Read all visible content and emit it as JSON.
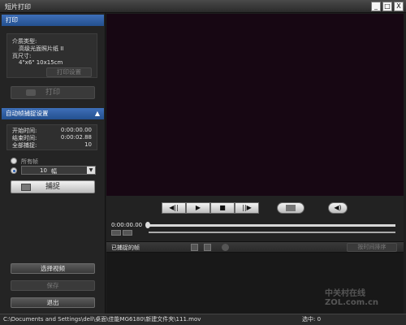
{
  "window": {
    "title": "短片打印",
    "buttons": [
      "_",
      "□",
      "X"
    ]
  },
  "print_section": {
    "header": "打印",
    "media_type_label": "介质类型:",
    "media_type_value": "高级光面照片纸 II",
    "page_size_label": "页尺寸:",
    "page_size_value": "4\"x6\" 10x15cm",
    "print_settings_button": "打印设置",
    "print_button": "打印"
  },
  "capture_section": {
    "header": "自动帧捕捉设置",
    "start_label": "开始时间:",
    "start_value": "0:00:00.00",
    "end_label": "结束时间:",
    "end_value": "0:00:02.88",
    "total_label": "全部捕捉:",
    "total_value": "10",
    "all_frames_option": "所有帧",
    "count_value": "10",
    "count_unit": "幅",
    "capture_button": "捕捉"
  },
  "bottom_buttons": {
    "select_video": "选择视频",
    "save": "保存",
    "exit": "退出"
  },
  "player": {
    "time": "0:00:00.00",
    "icons": [
      "rewind-icon",
      "play-icon",
      "stop-icon",
      "forward-icon",
      "capture-icon",
      "volume-icon"
    ]
  },
  "captured": {
    "header": "已捕捉的帧",
    "sort_button": "按时间排序"
  },
  "status": {
    "path": "C:\\Documents and Settings\\dell\\桌面\\佳能MG6180\\新建文件夹\\111.mov",
    "selected": "选中: 0"
  },
  "watermark": "中关村在线 ZOL.com.cn",
  "colors": {
    "accent": "#2f5fa8",
    "video_bg": "#170713"
  }
}
